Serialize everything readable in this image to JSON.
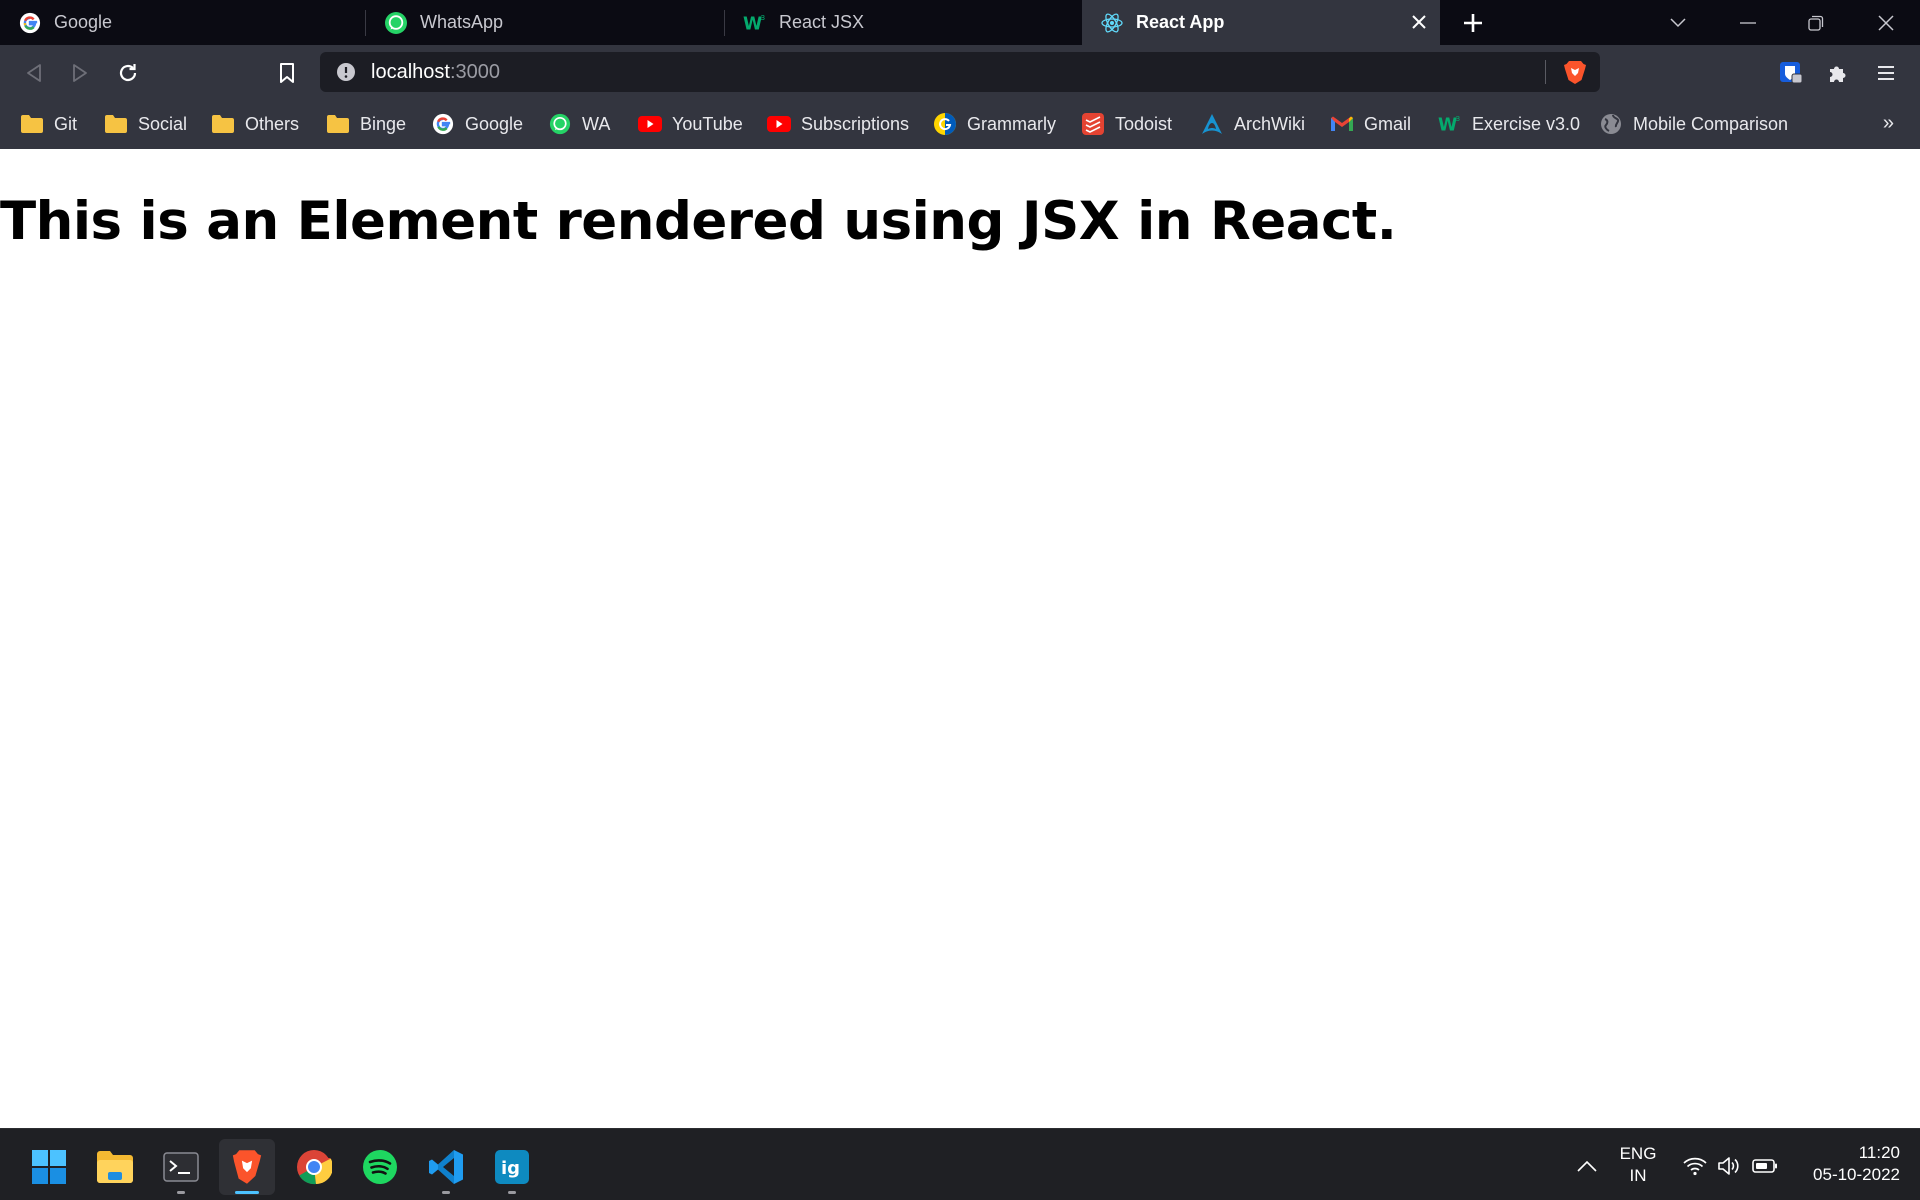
{
  "browser": {
    "tabs": [
      {
        "label": "Google",
        "icon": "google-icon",
        "active": false
      },
      {
        "label": "WhatsApp",
        "icon": "whatsapp-icon",
        "active": false
      },
      {
        "label": "React JSX",
        "icon": "w3schools-icon",
        "active": false
      },
      {
        "label": "React App",
        "icon": "react-icon",
        "active": true
      }
    ],
    "address": {
      "host": "localhost",
      "port": ":3000"
    },
    "bookmarks": [
      {
        "label": "Git",
        "icon": "folder-icon"
      },
      {
        "label": "Social",
        "icon": "folder-icon"
      },
      {
        "label": "Others",
        "icon": "folder-icon"
      },
      {
        "label": "Binge",
        "icon": "folder-icon"
      },
      {
        "label": "Google",
        "icon": "google-icon"
      },
      {
        "label": "WA",
        "icon": "whatsapp-icon"
      },
      {
        "label": "YouTube",
        "icon": "youtube-icon"
      },
      {
        "label": "Subscriptions",
        "icon": "youtube-icon"
      },
      {
        "label": "Grammarly",
        "icon": "grammarly-icon"
      },
      {
        "label": "Todoist",
        "icon": "todoist-icon"
      },
      {
        "label": "ArchWiki",
        "icon": "arch-icon"
      },
      {
        "label": "Gmail",
        "icon": "gmail-icon"
      },
      {
        "label": "Exercise v3.0",
        "icon": "w3schools-icon"
      },
      {
        "label": "Mobile Comparison",
        "icon": "globe-icon"
      }
    ],
    "bookmarks_more": "»"
  },
  "page": {
    "heading": "This is an Element rendered using JSX in React."
  },
  "taskbar": {
    "lang_line1": "ENG",
    "lang_line2": "IN",
    "time": "11:20",
    "date": "05-10-2022"
  },
  "colors": {
    "tabstrip": "#0b0b13",
    "toolbar": "#33353f",
    "taskbar": "#1f2024",
    "accent": "#4cc2ff"
  }
}
